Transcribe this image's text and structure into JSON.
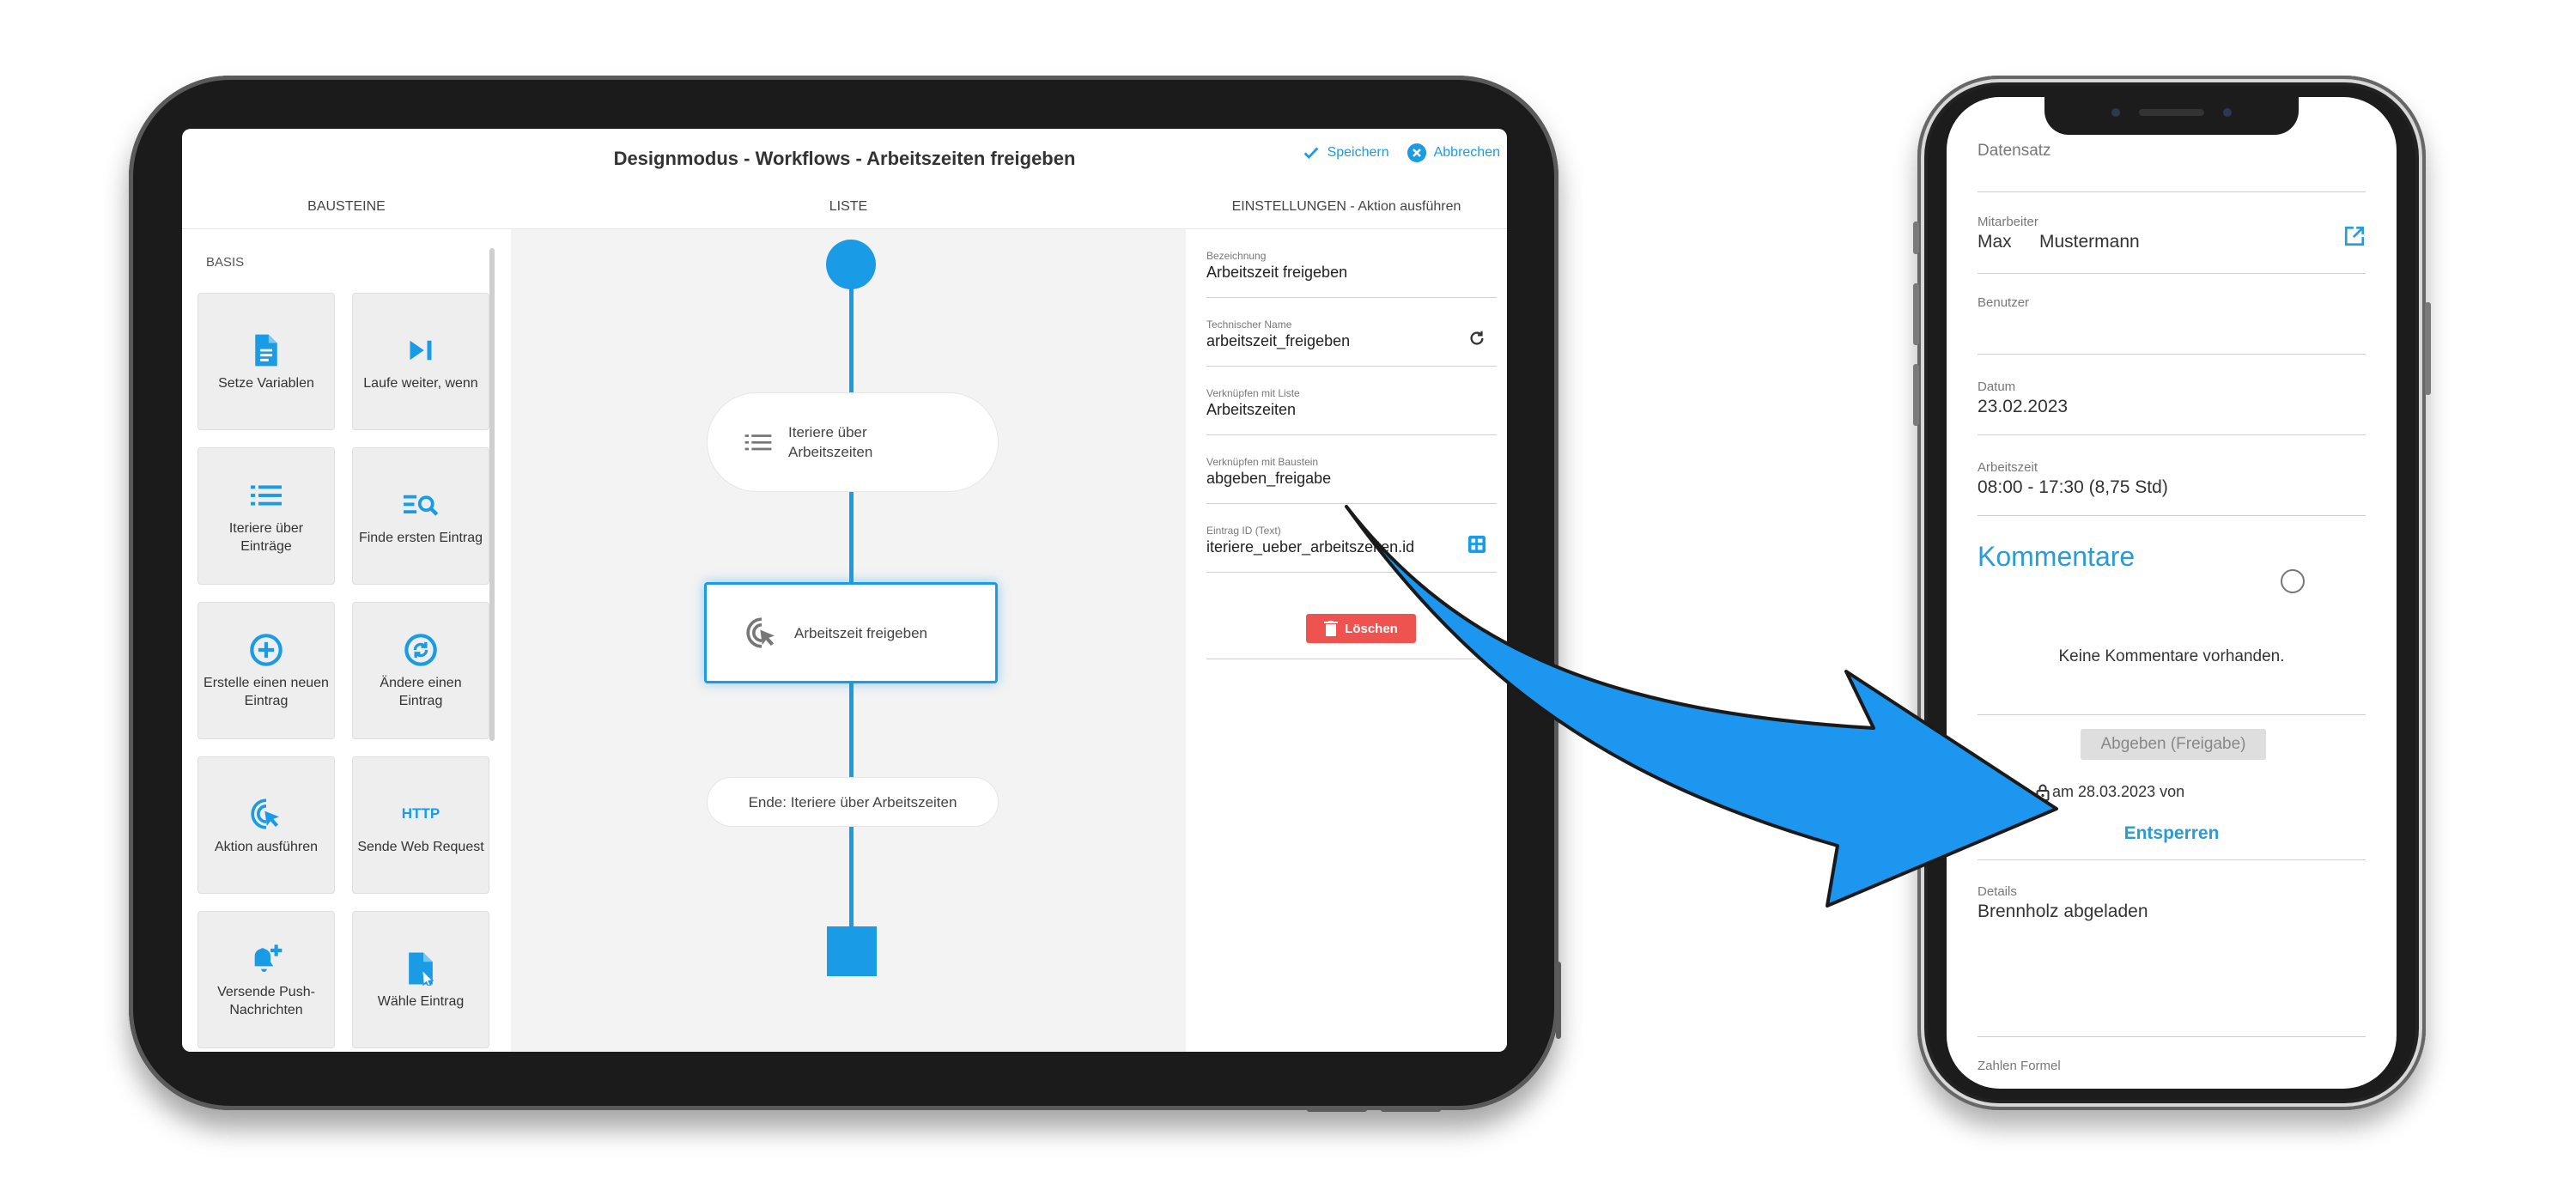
{
  "tablet": {
    "title": "Designmodus - Workflows - Arbeitszeiten freigeben",
    "save_label": "Speichern",
    "cancel_label": "Abbrechen",
    "columns": {
      "left": "BAUSTEINE",
      "middle": "LISTE",
      "right": "EINSTELLUNGEN - Aktion ausführen"
    },
    "section_label": "BASIS",
    "tiles": [
      {
        "label": "Setze Variablen",
        "icon": "document-icon"
      },
      {
        "label": "Laufe weiter, wenn",
        "icon": "skip-next-icon"
      },
      {
        "label": "Iteriere über Einträge",
        "icon": "list-icon"
      },
      {
        "label": "Finde ersten Eintrag",
        "icon": "list-search-icon"
      },
      {
        "label": "Erstelle einen neuen Eintrag",
        "icon": "plus-circle-icon"
      },
      {
        "label": "Ändere einen Eintrag",
        "icon": "sync-circle-icon"
      },
      {
        "label": "Aktion ausführen",
        "icon": "cursor-click-icon"
      },
      {
        "label": "Sende Web Request",
        "icon": "http-icon",
        "icon_text": "HTTP"
      },
      {
        "label": "Versende Push-Nachrichten",
        "icon": "bell-plus-icon"
      },
      {
        "label": "Wähle Eintrag",
        "icon": "file-cursor-icon"
      }
    ],
    "flow": {
      "node1": "Iteriere über Arbeitszeiten",
      "node2": "Arbeitszeit freigeben",
      "node3": "Ende: Iteriere über Arbeitszeiten"
    },
    "settings": {
      "fields": [
        {
          "label": "Bezeichnung",
          "value": "Arbeitszeit freigeben"
        },
        {
          "label": "Technischer Name",
          "value": "arbeitszeit_freigeben"
        },
        {
          "label": "Verknüpfen mit Liste",
          "value": "Arbeitszeiten"
        },
        {
          "label": "Verknüpfen mit Baustein",
          "value": "abgeben_freigabe"
        },
        {
          "label": "Eintrag ID (Text)",
          "value": "iteriere_ueber_arbeitszeiten.id"
        }
      ],
      "delete_label": "Löschen"
    }
  },
  "phone": {
    "header": "Datensatz",
    "mitarbeiter_label": "Mitarbeiter",
    "mitarbeiter_first": "Max",
    "mitarbeiter_last": "Mustermann",
    "benutzer_label": "Benutzer",
    "datum_label": "Datum",
    "datum_value": "23.02.2023",
    "arbeitszeit_label": "Arbeitszeit",
    "arbeitszeit_value": "08:00 - 17:30 (8,75 Std)",
    "kommentare_title": "Kommentare",
    "no_comments": "Keine Kommentare vorhanden.",
    "abgeben_button": "Abgeben (Freigabe)",
    "lock_text": "am 28.03.2023 von",
    "entsperren": "Entsperren",
    "details_label": "Details",
    "details_value": "Brennholz abgeladen",
    "cut_label": "Zahlen Formel"
  },
  "colors": {
    "accent": "#1a9be6",
    "phone_accent": "#2b9bd4",
    "delete": "#ef5350",
    "arrow": "#1d96f0"
  }
}
